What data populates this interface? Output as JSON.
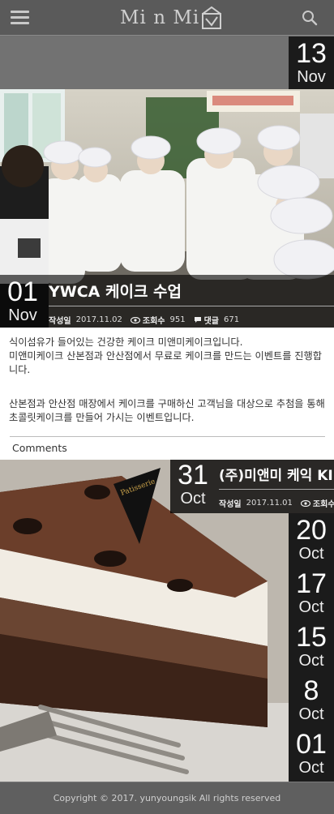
{
  "header": {
    "logo_text": "Mi n Mi",
    "menu_icon": "hamburger-icon",
    "search_icon": "search-icon"
  },
  "top_date": {
    "day": "13",
    "month": "Nov"
  },
  "post1": {
    "day": "01",
    "month": "Nov",
    "title": "YWCA 케이크 수업",
    "date_label": "작성일",
    "date": "2017.11.02",
    "views_label": "조회수",
    "views": "951",
    "comments_label": "댓글",
    "comments_count": "671",
    "para1": "식이섬유가 들어있는 건강한 케이크 미앤미케이크입니다.\n미앤미케이크 산본점과 안산점에서 무료로 케이크를 만드는 이벤트를 진행합니다.",
    "para2": "산본점과 안산점 매장에서 케이크를 구매하신 고객님을 대상으로 추첨을 통해 초콜릿케이크를 만들어 가시는 이벤트입니다.",
    "comments_link": "Comments"
  },
  "post2": {
    "day": "31",
    "month": "Oct",
    "title": "(주)미앤미 케익 KI",
    "date_label": "작성일",
    "date": "2017.11.01",
    "views_label": "조회수"
  },
  "date_list": [
    {
      "day": "20",
      "month": "Oct"
    },
    {
      "day": "17",
      "month": "Oct"
    },
    {
      "day": "15",
      "month": "Oct"
    },
    {
      "day": "8",
      "month": "Oct"
    },
    {
      "day": "01",
      "month": "Oct"
    }
  ],
  "cake_topper_text": "Patisserie",
  "footer": {
    "copyright": "Copyright © 2017. yunyoungsik All rights reserved"
  },
  "colors": {
    "header_bg": "#5a5a5a",
    "date_box_bg": "#1b1b1b",
    "footer_bg": "#5f5f5f"
  }
}
